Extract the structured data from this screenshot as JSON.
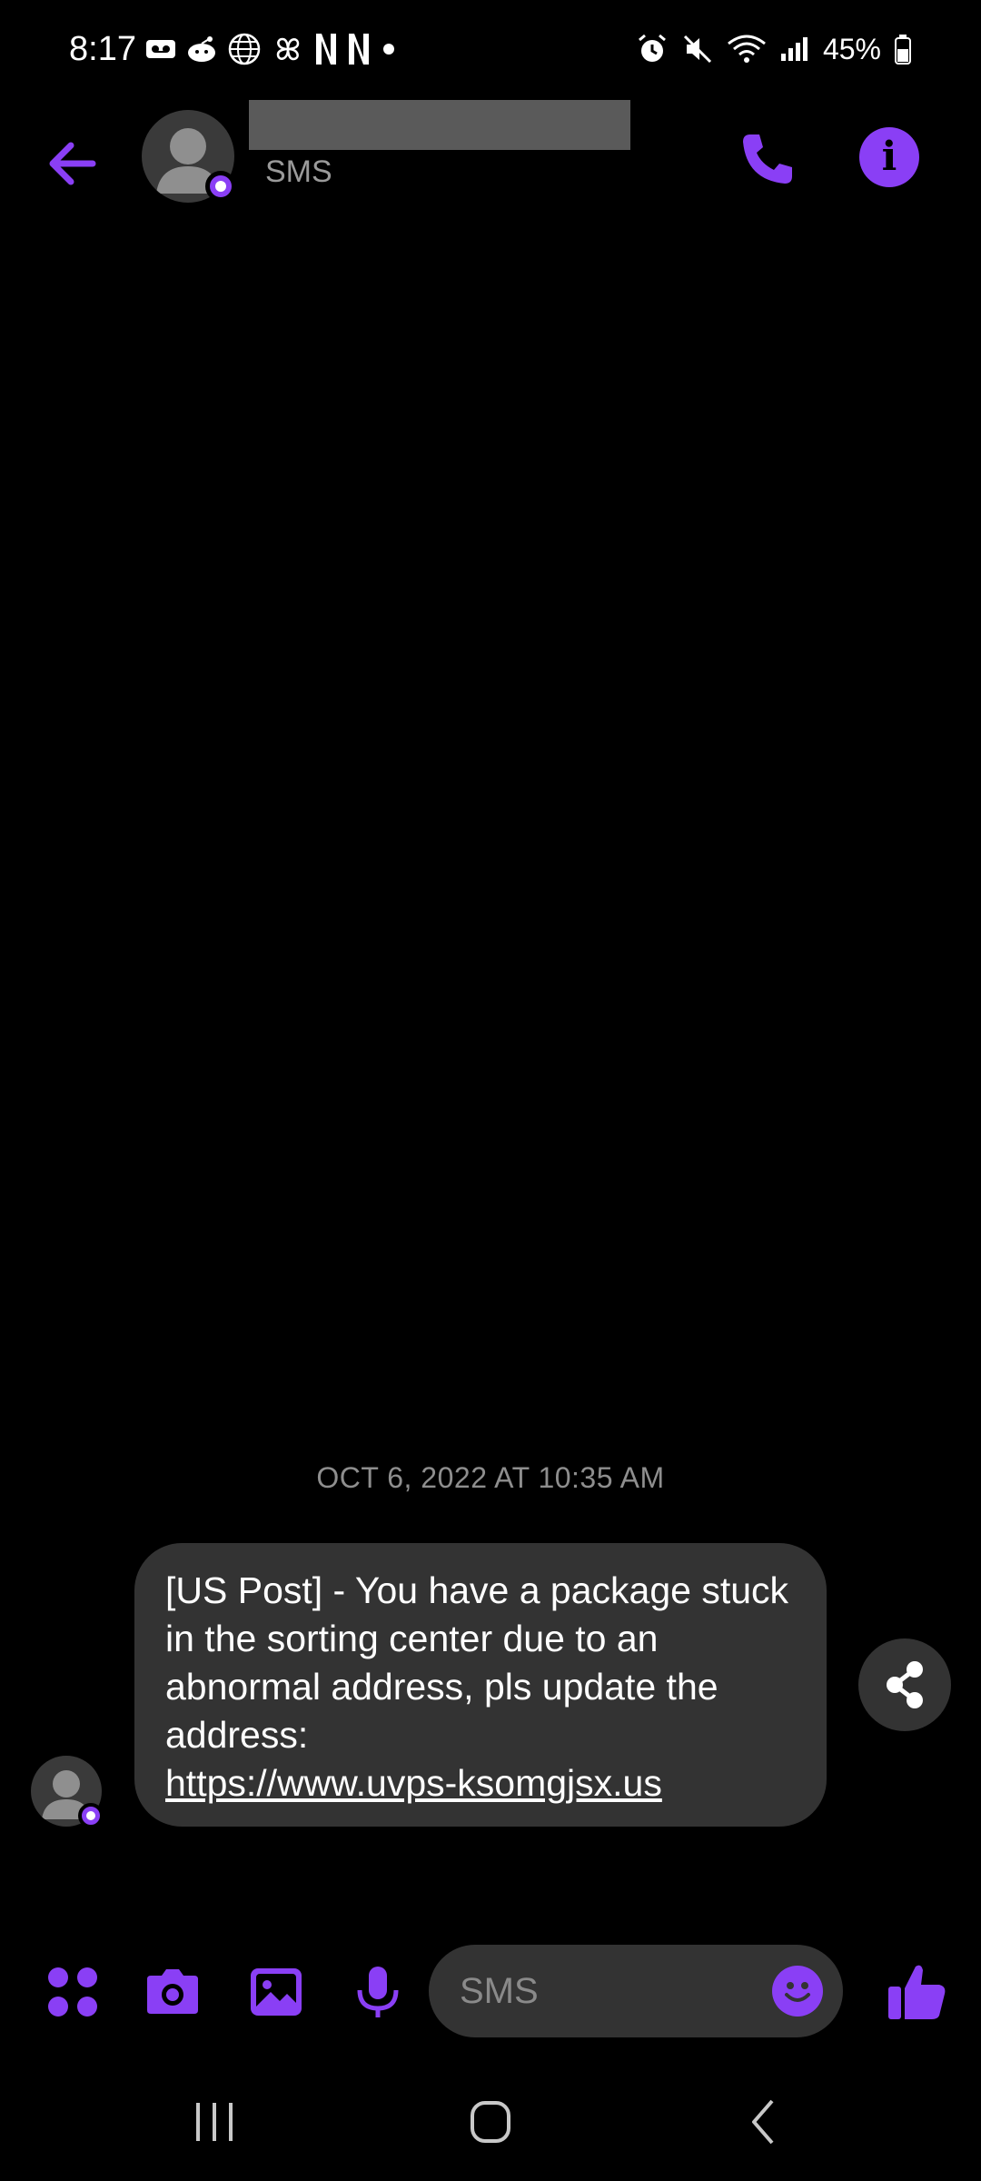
{
  "status_bar": {
    "time": "8:17",
    "left_icons": [
      "voicemail-icon",
      "reddit-icon",
      "globe-icon",
      "pinwheel-icon",
      "netflix-icon",
      "netflix-icon",
      "dot-icon"
    ],
    "right_icons": [
      "alarm-icon",
      "mute-icon",
      "wifi-icon",
      "signal-icon"
    ],
    "battery": "45%"
  },
  "header": {
    "contact_subtitle": "SMS",
    "back_icon": "arrow-left-icon",
    "call_icon": "phone-icon",
    "info_icon": "info-icon",
    "info_glyph": "i"
  },
  "conversation": {
    "timestamp": "OCT 6, 2022 AT 10:35 AM",
    "message_text": "[US Post] - You have a package stuck in the sorting center due to an abnormal address, pls update the address:",
    "message_link": "https://www.uvps-ksomgjsx.us"
  },
  "composer": {
    "placeholder": "SMS",
    "icons": [
      "apps-icon",
      "camera-icon",
      "gallery-icon",
      "mic-icon",
      "emoji-icon",
      "thumbs-up-icon"
    ]
  },
  "nav_bar": {
    "icons": [
      "recent-apps-icon",
      "home-icon",
      "back-icon"
    ]
  },
  "colors": {
    "accent": "#8a3ff5",
    "background": "#000000",
    "bubble": "#333333",
    "muted_text": "#8e8e8e"
  }
}
